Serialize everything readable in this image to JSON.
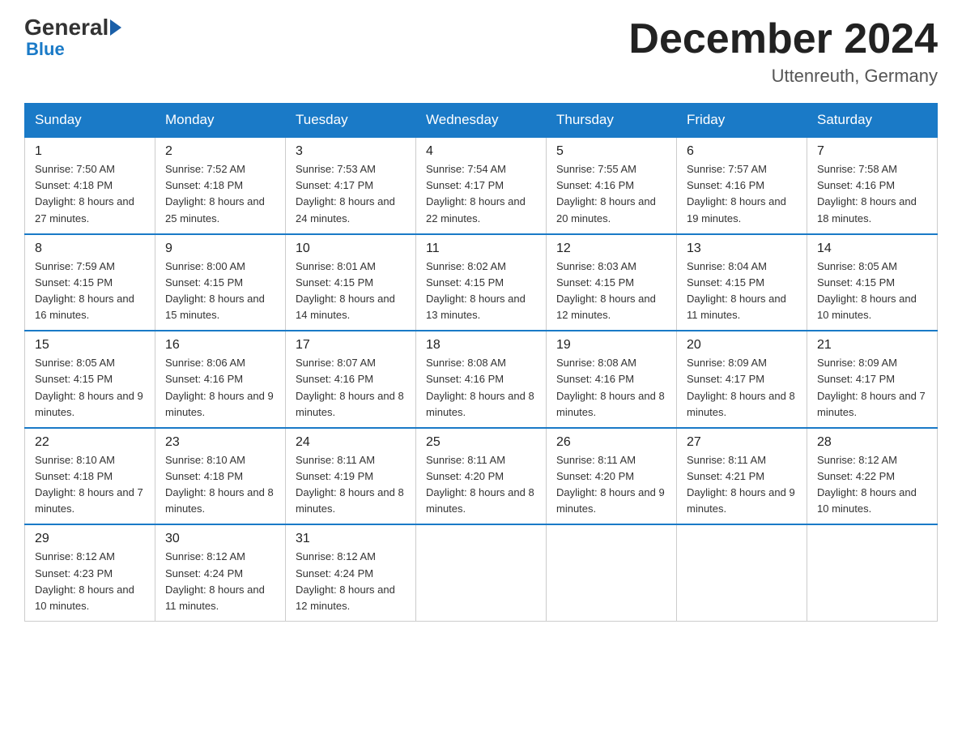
{
  "header": {
    "logo_general": "General",
    "logo_blue": "Blue",
    "month_title": "December 2024",
    "location": "Uttenreuth, Germany"
  },
  "days_of_week": [
    "Sunday",
    "Monday",
    "Tuesday",
    "Wednesday",
    "Thursday",
    "Friday",
    "Saturday"
  ],
  "weeks": [
    [
      {
        "day": "1",
        "sunrise": "7:50 AM",
        "sunset": "4:18 PM",
        "daylight": "8 hours and 27 minutes."
      },
      {
        "day": "2",
        "sunrise": "7:52 AM",
        "sunset": "4:18 PM",
        "daylight": "8 hours and 25 minutes."
      },
      {
        "day": "3",
        "sunrise": "7:53 AM",
        "sunset": "4:17 PM",
        "daylight": "8 hours and 24 minutes."
      },
      {
        "day": "4",
        "sunrise": "7:54 AM",
        "sunset": "4:17 PM",
        "daylight": "8 hours and 22 minutes."
      },
      {
        "day": "5",
        "sunrise": "7:55 AM",
        "sunset": "4:16 PM",
        "daylight": "8 hours and 20 minutes."
      },
      {
        "day": "6",
        "sunrise": "7:57 AM",
        "sunset": "4:16 PM",
        "daylight": "8 hours and 19 minutes."
      },
      {
        "day": "7",
        "sunrise": "7:58 AM",
        "sunset": "4:16 PM",
        "daylight": "8 hours and 18 minutes."
      }
    ],
    [
      {
        "day": "8",
        "sunrise": "7:59 AM",
        "sunset": "4:15 PM",
        "daylight": "8 hours and 16 minutes."
      },
      {
        "day": "9",
        "sunrise": "8:00 AM",
        "sunset": "4:15 PM",
        "daylight": "8 hours and 15 minutes."
      },
      {
        "day": "10",
        "sunrise": "8:01 AM",
        "sunset": "4:15 PM",
        "daylight": "8 hours and 14 minutes."
      },
      {
        "day": "11",
        "sunrise": "8:02 AM",
        "sunset": "4:15 PM",
        "daylight": "8 hours and 13 minutes."
      },
      {
        "day": "12",
        "sunrise": "8:03 AM",
        "sunset": "4:15 PM",
        "daylight": "8 hours and 12 minutes."
      },
      {
        "day": "13",
        "sunrise": "8:04 AM",
        "sunset": "4:15 PM",
        "daylight": "8 hours and 11 minutes."
      },
      {
        "day": "14",
        "sunrise": "8:05 AM",
        "sunset": "4:15 PM",
        "daylight": "8 hours and 10 minutes."
      }
    ],
    [
      {
        "day": "15",
        "sunrise": "8:05 AM",
        "sunset": "4:15 PM",
        "daylight": "8 hours and 9 minutes."
      },
      {
        "day": "16",
        "sunrise": "8:06 AM",
        "sunset": "4:16 PM",
        "daylight": "8 hours and 9 minutes."
      },
      {
        "day": "17",
        "sunrise": "8:07 AM",
        "sunset": "4:16 PM",
        "daylight": "8 hours and 8 minutes."
      },
      {
        "day": "18",
        "sunrise": "8:08 AM",
        "sunset": "4:16 PM",
        "daylight": "8 hours and 8 minutes."
      },
      {
        "day": "19",
        "sunrise": "8:08 AM",
        "sunset": "4:16 PM",
        "daylight": "8 hours and 8 minutes."
      },
      {
        "day": "20",
        "sunrise": "8:09 AM",
        "sunset": "4:17 PM",
        "daylight": "8 hours and 8 minutes."
      },
      {
        "day": "21",
        "sunrise": "8:09 AM",
        "sunset": "4:17 PM",
        "daylight": "8 hours and 7 minutes."
      }
    ],
    [
      {
        "day": "22",
        "sunrise": "8:10 AM",
        "sunset": "4:18 PM",
        "daylight": "8 hours and 7 minutes."
      },
      {
        "day": "23",
        "sunrise": "8:10 AM",
        "sunset": "4:18 PM",
        "daylight": "8 hours and 8 minutes."
      },
      {
        "day": "24",
        "sunrise": "8:11 AM",
        "sunset": "4:19 PM",
        "daylight": "8 hours and 8 minutes."
      },
      {
        "day": "25",
        "sunrise": "8:11 AM",
        "sunset": "4:20 PM",
        "daylight": "8 hours and 8 minutes."
      },
      {
        "day": "26",
        "sunrise": "8:11 AM",
        "sunset": "4:20 PM",
        "daylight": "8 hours and 9 minutes."
      },
      {
        "day": "27",
        "sunrise": "8:11 AM",
        "sunset": "4:21 PM",
        "daylight": "8 hours and 9 minutes."
      },
      {
        "day": "28",
        "sunrise": "8:12 AM",
        "sunset": "4:22 PM",
        "daylight": "8 hours and 10 minutes."
      }
    ],
    [
      {
        "day": "29",
        "sunrise": "8:12 AM",
        "sunset": "4:23 PM",
        "daylight": "8 hours and 10 minutes."
      },
      {
        "day": "30",
        "sunrise": "8:12 AM",
        "sunset": "4:24 PM",
        "daylight": "8 hours and 11 minutes."
      },
      {
        "day": "31",
        "sunrise": "8:12 AM",
        "sunset": "4:24 PM",
        "daylight": "8 hours and 12 minutes."
      },
      null,
      null,
      null,
      null
    ]
  ]
}
